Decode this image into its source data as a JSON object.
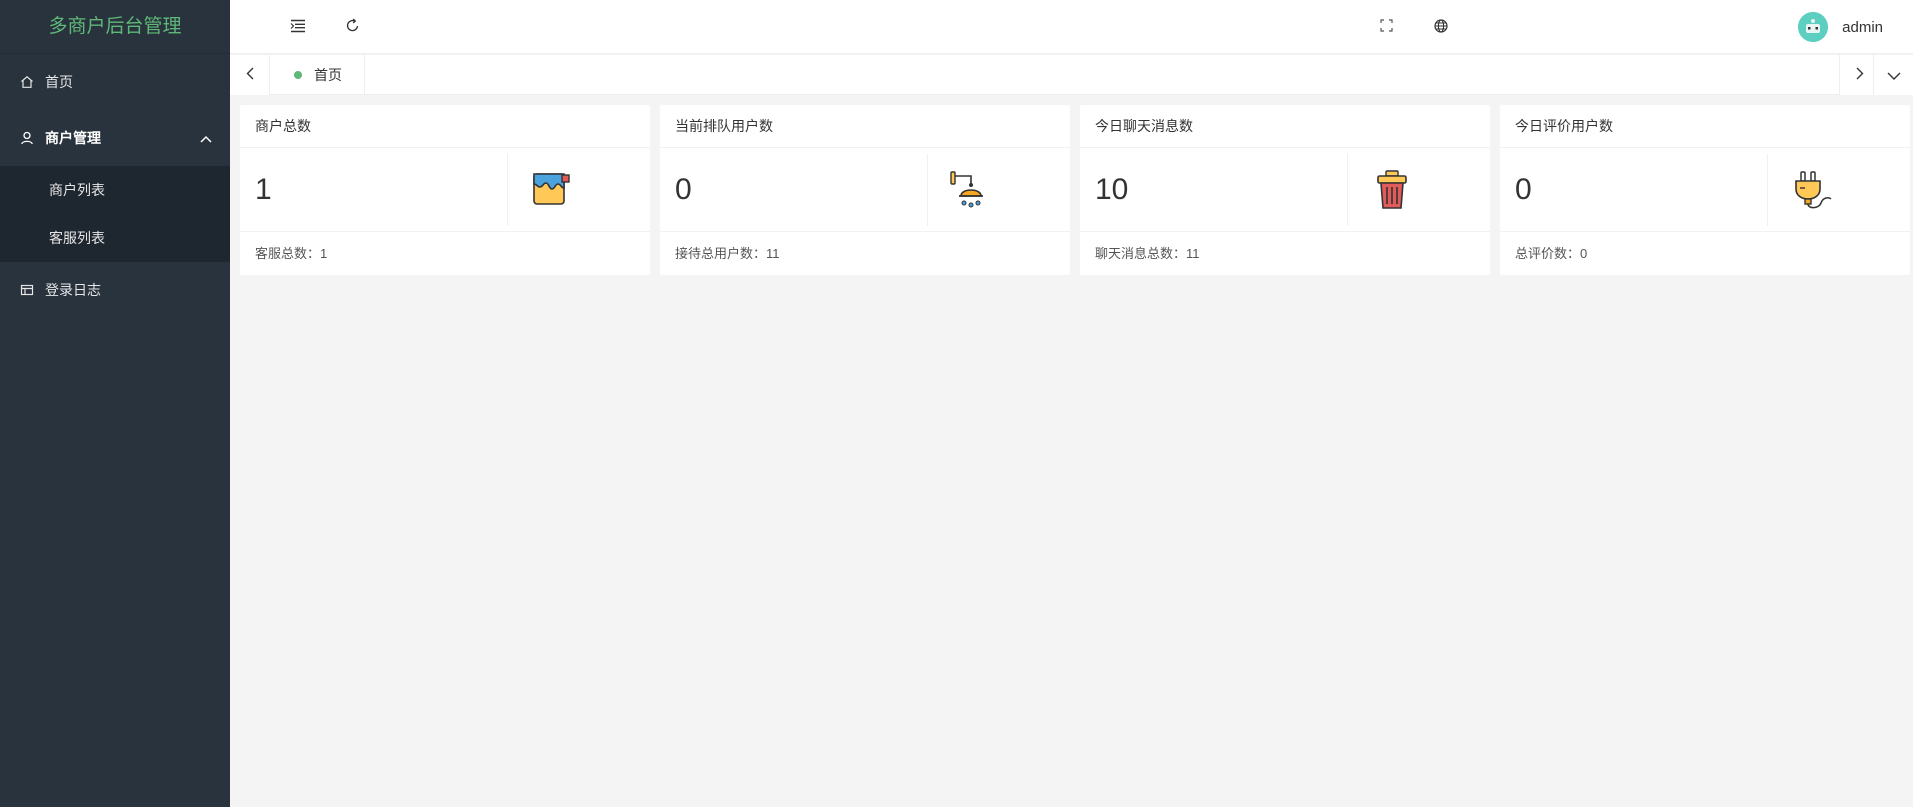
{
  "app": {
    "title": "多商户后台管理"
  },
  "sidebar": {
    "items": [
      {
        "label": "首页",
        "icon": "home-icon"
      },
      {
        "label": "商户管理",
        "icon": "user-icon",
        "expanded": true,
        "children": [
          {
            "label": "商户列表"
          },
          {
            "label": "客服列表"
          }
        ]
      },
      {
        "label": "登录日志",
        "icon": "log-icon"
      }
    ]
  },
  "header": {
    "user_name": "admin",
    "icons": [
      "menu-fold-icon",
      "refresh-icon",
      "fullscreen-icon",
      "globe-icon"
    ]
  },
  "tabs": {
    "items": [
      {
        "label": "首页",
        "active": true
      }
    ]
  },
  "cards": [
    {
      "title": "商户总数",
      "value": "1",
      "footer": "客服总数：1",
      "icon": "paint-bucket-icon"
    },
    {
      "title": "当前排队用户数",
      "value": "0",
      "footer": "接待总用户数：11",
      "icon": "shower-icon"
    },
    {
      "title": "今日聊天消息数",
      "value": "10",
      "footer": "聊天消息总数：11",
      "icon": "trash-can-icon"
    },
    {
      "title": "今日评价用户数",
      "value": "0",
      "footer": "总评价数：0",
      "icon": "plug-icon"
    }
  ],
  "colors": {
    "sidebar": "#28333e",
    "submenu": "#1e2730",
    "accent": "#5fb878",
    "background": "#f4f4f4"
  }
}
